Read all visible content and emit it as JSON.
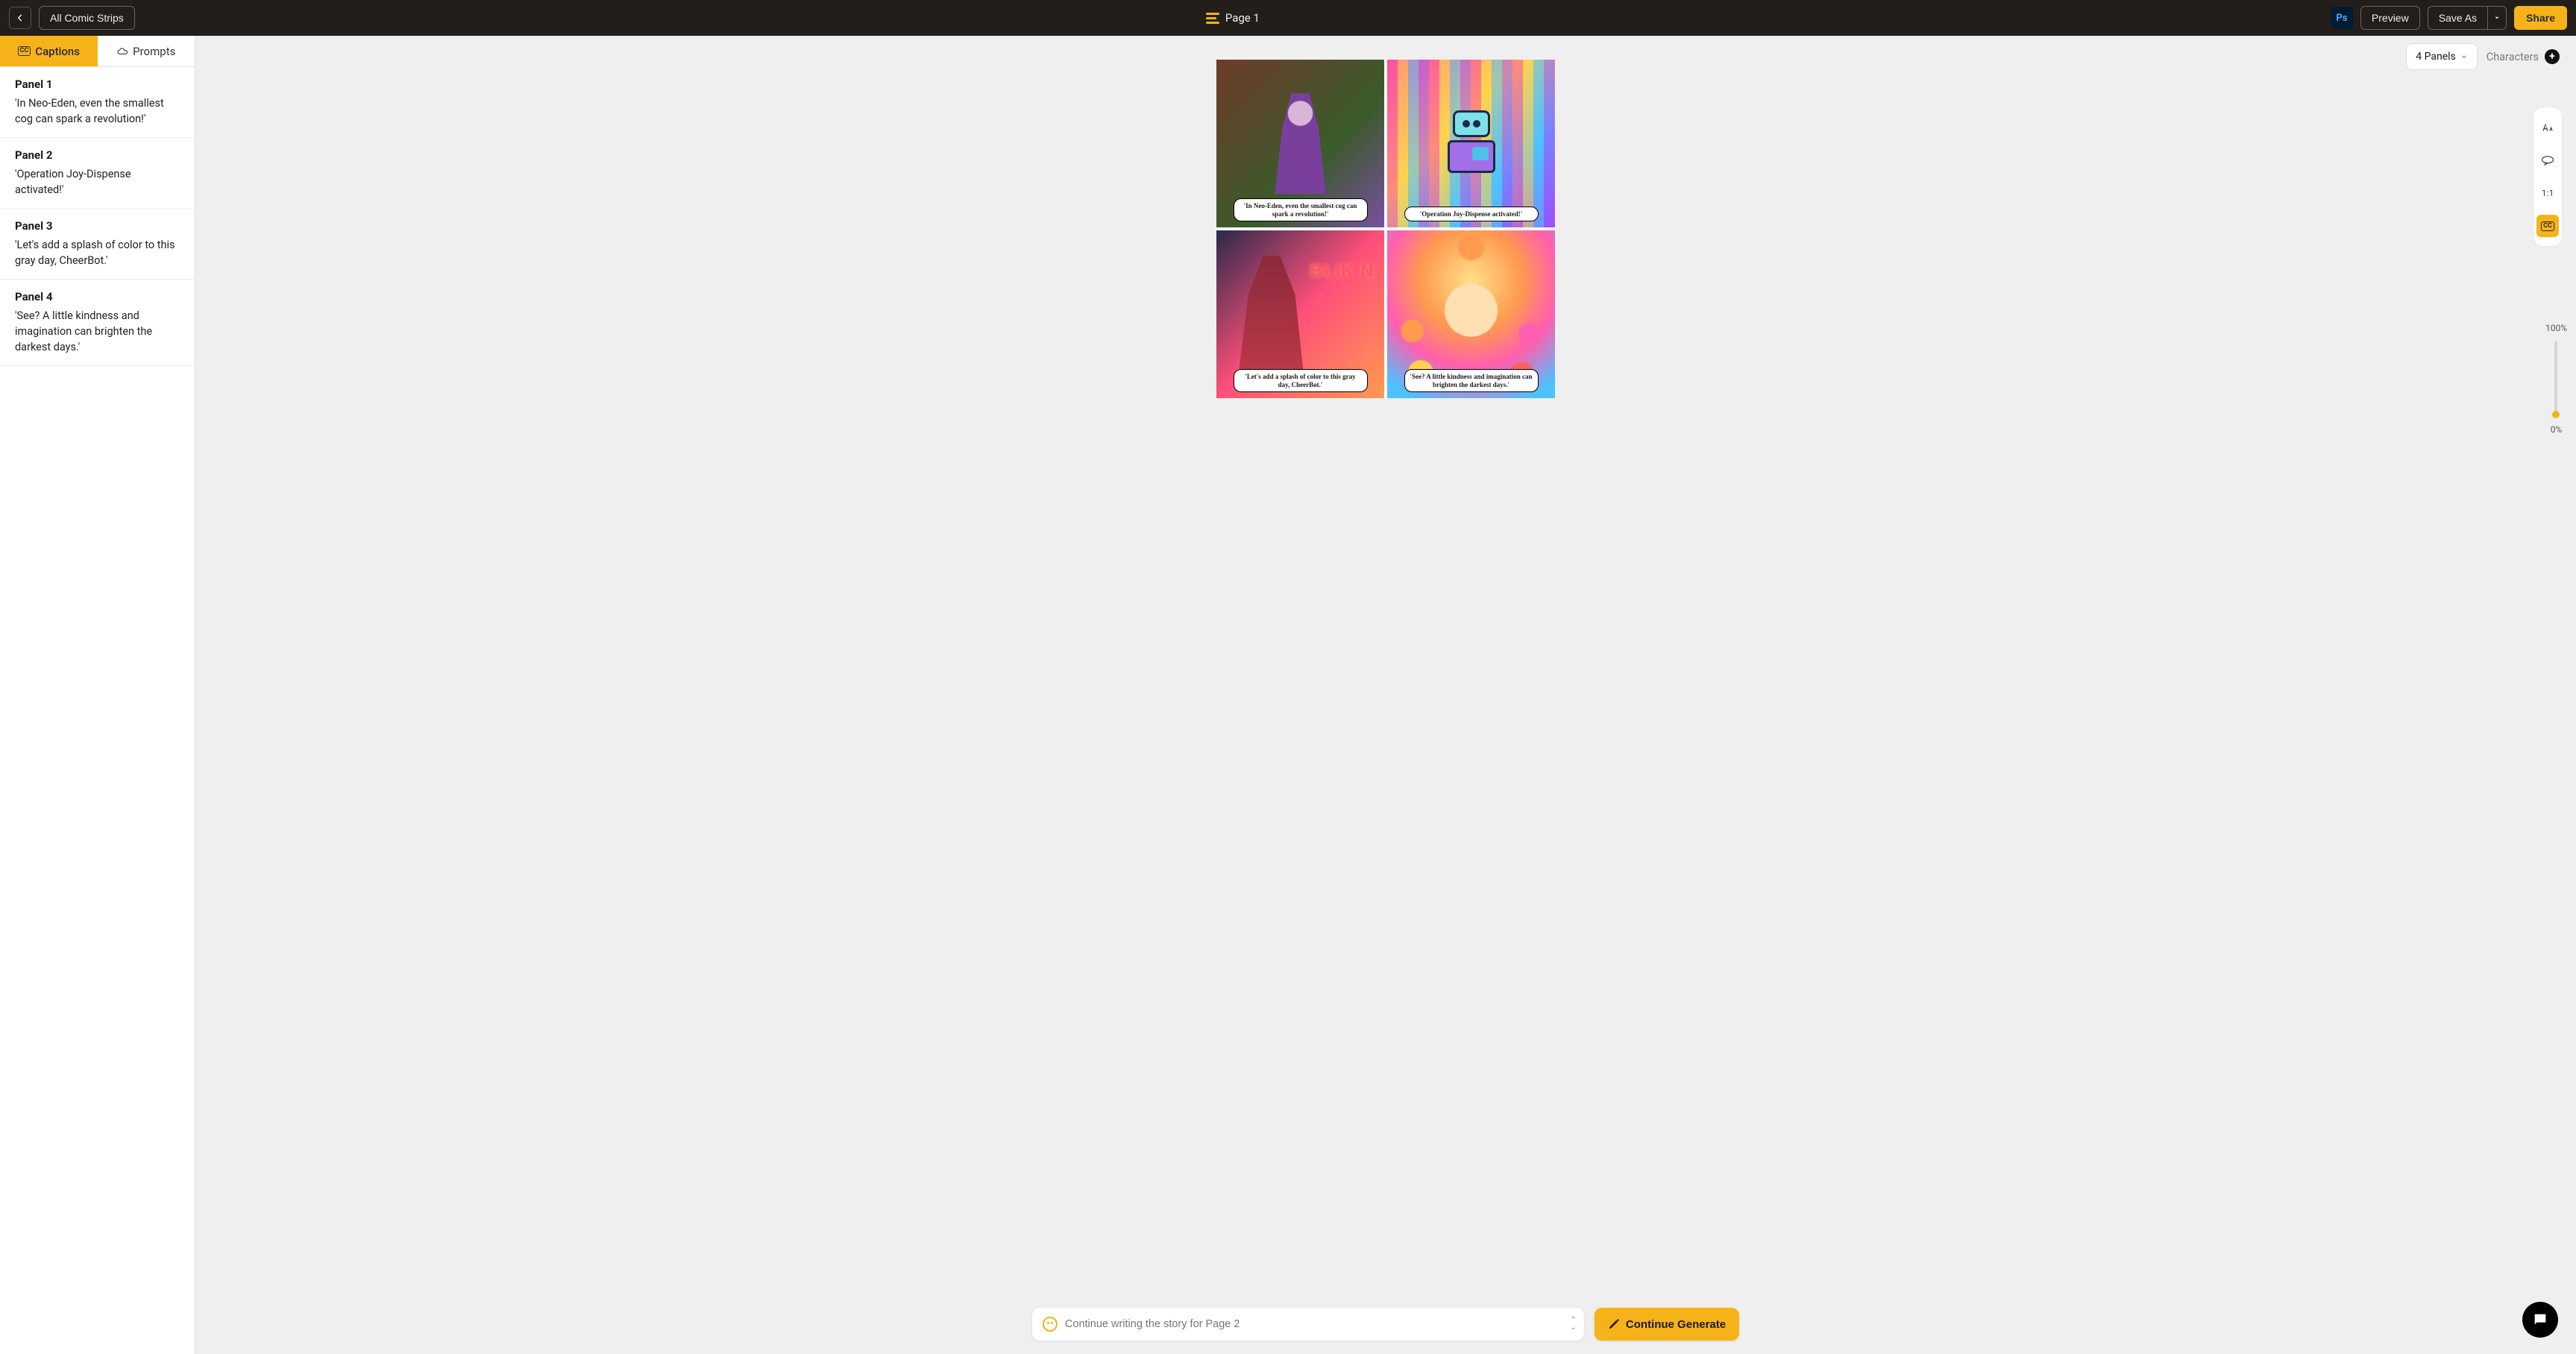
{
  "topbar": {
    "all_strips": "All Comic Strips",
    "page_title": "Page 1",
    "preview": "Preview",
    "save_as": "Save As",
    "share": "Share",
    "ps": "Ps"
  },
  "sidebar": {
    "tab_captions": "Captions",
    "tab_prompts": "Prompts",
    "panels": [
      {
        "title": "Panel 1",
        "caption": "'In Neo-Eden, even the smallest cog can spark a revolution!'"
      },
      {
        "title": "Panel 2",
        "caption": "'Operation Joy-Dispense activated!'"
      },
      {
        "title": "Panel 3",
        "caption": "'Let's add a splash of color to this gray day, CheerBot.'"
      },
      {
        "title": "Panel 4",
        "caption": "'See? A little kindness and imagination can brighten the darkest days.'"
      }
    ]
  },
  "canvas": {
    "panels_select": "4 Panels",
    "characters": "Characters",
    "neon_sign": "BLIK N",
    "panel_captions": [
      "'In Neo-Eden, even the smallest cog can spark a revolution!'",
      "'Operation Joy-Dispense activated!'",
      "'Let's add a splash of color to this gray day, CheerBot.'",
      "'See? A little kindness and imagination can brighten the darkest days.'"
    ],
    "right_tools": {
      "ratio": "1:1"
    },
    "zoom_top": "100%",
    "zoom_bottom": "0%"
  },
  "bottom": {
    "placeholder": "Continue writing the story for Page 2",
    "continue": "Continue Generate"
  }
}
